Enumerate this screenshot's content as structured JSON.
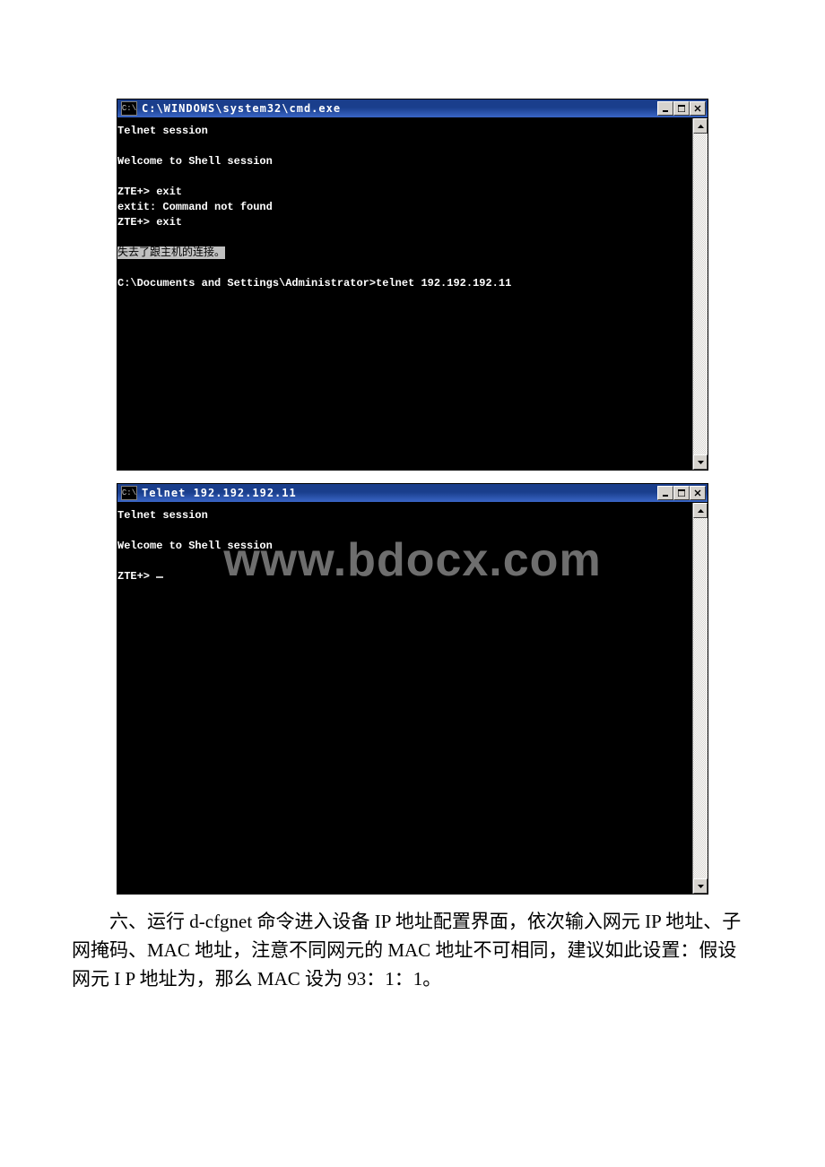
{
  "win1": {
    "icon_text": "C:\\",
    "title": "C:\\WINDOWS\\system32\\cmd.exe",
    "lines": {
      "l1": "Telnet session",
      "l2": "Welcome to Shell session",
      "l3": "ZTE+> exit",
      "l4": "extit: Command not found",
      "l5": "ZTE+> exit",
      "l6": "失去了跟主机的连接。",
      "l7": "C:\\Documents and Settings\\Administrator>telnet 192.192.192.11"
    }
  },
  "win2": {
    "icon_text": "C:\\",
    "title": "Telnet 192.192.192.11",
    "lines": {
      "l1": "Telnet session",
      "l2": "Welcome to Shell session",
      "l3": "ZTE+> "
    }
  },
  "watermark": "www.bdocx.com",
  "body": {
    "p1": "六、运行 d-cfgnet 命令进入设备 IP 地址配置界面，依次输入网元 IP 地址、子网掩码、MAC 地址，注意不同网元的 MAC 地址不可相同，建议如此设置：假设网元 I P 地址为，那么 MAC 设为 93：1：1。"
  }
}
